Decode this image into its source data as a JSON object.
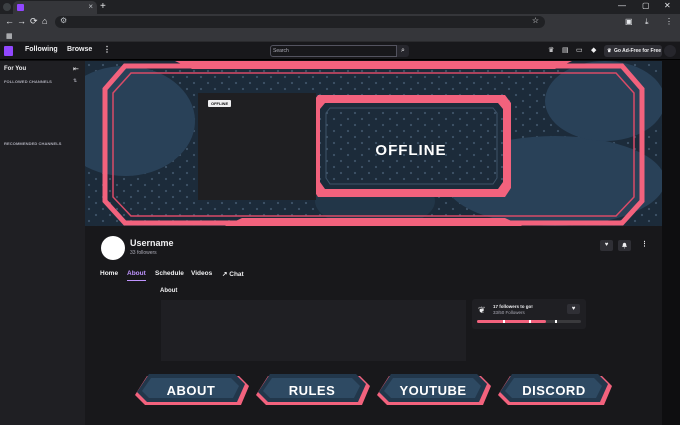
{
  "browser": {
    "tab_close": "×",
    "new_tab": "+",
    "window_controls": [
      "—",
      "▢",
      "✕"
    ],
    "nav_icons": [
      "←",
      "→",
      "⟳",
      "⌂"
    ],
    "star_icon": "☆"
  },
  "twitch_nav": {
    "following": "Following",
    "browse": "Browse",
    "more": "⋮",
    "search_placeholder": "Search",
    "search_icon": "⌕",
    "adfree": "Go Ad-Free for Free",
    "icons": [
      "crown-icon",
      "inbox-icon",
      "whispers-icon",
      "bits-icon"
    ]
  },
  "sidebar": {
    "title": "For You",
    "collapse_icon": "⇤",
    "followed_label": "FOLLOWED CHANNELS",
    "sort_icon": "⇅",
    "recommended_label": "RECOMMENDED CHANNELS"
  },
  "banner": {
    "offline_badge": "OFFLINE",
    "offline_text": "OFFLINE"
  },
  "channel": {
    "name": "Username",
    "followers": "33 followers",
    "heart": "♥",
    "bell": "🔔",
    "more": "⋮"
  },
  "tabs": [
    {
      "label": "Home"
    },
    {
      "label": "About"
    },
    {
      "label": "Schedule"
    },
    {
      "label": "Videos"
    },
    {
      "label": "↗ Chat"
    }
  ],
  "about": {
    "title": "About"
  },
  "goal": {
    "text": "17 followers to go!",
    "progress_text": "33/50 Followers",
    "progress": 0.66,
    "heart": "♥"
  },
  "panels": [
    {
      "label": "ABOUT"
    },
    {
      "label": "RULES"
    },
    {
      "label": "YOUTUBE"
    },
    {
      "label": "DISCORD"
    }
  ],
  "colors": {
    "accent": "#bf94ff",
    "pink": "#f2627d",
    "banner_bg": "#1e2d3d",
    "twitch": "#9147ff"
  }
}
